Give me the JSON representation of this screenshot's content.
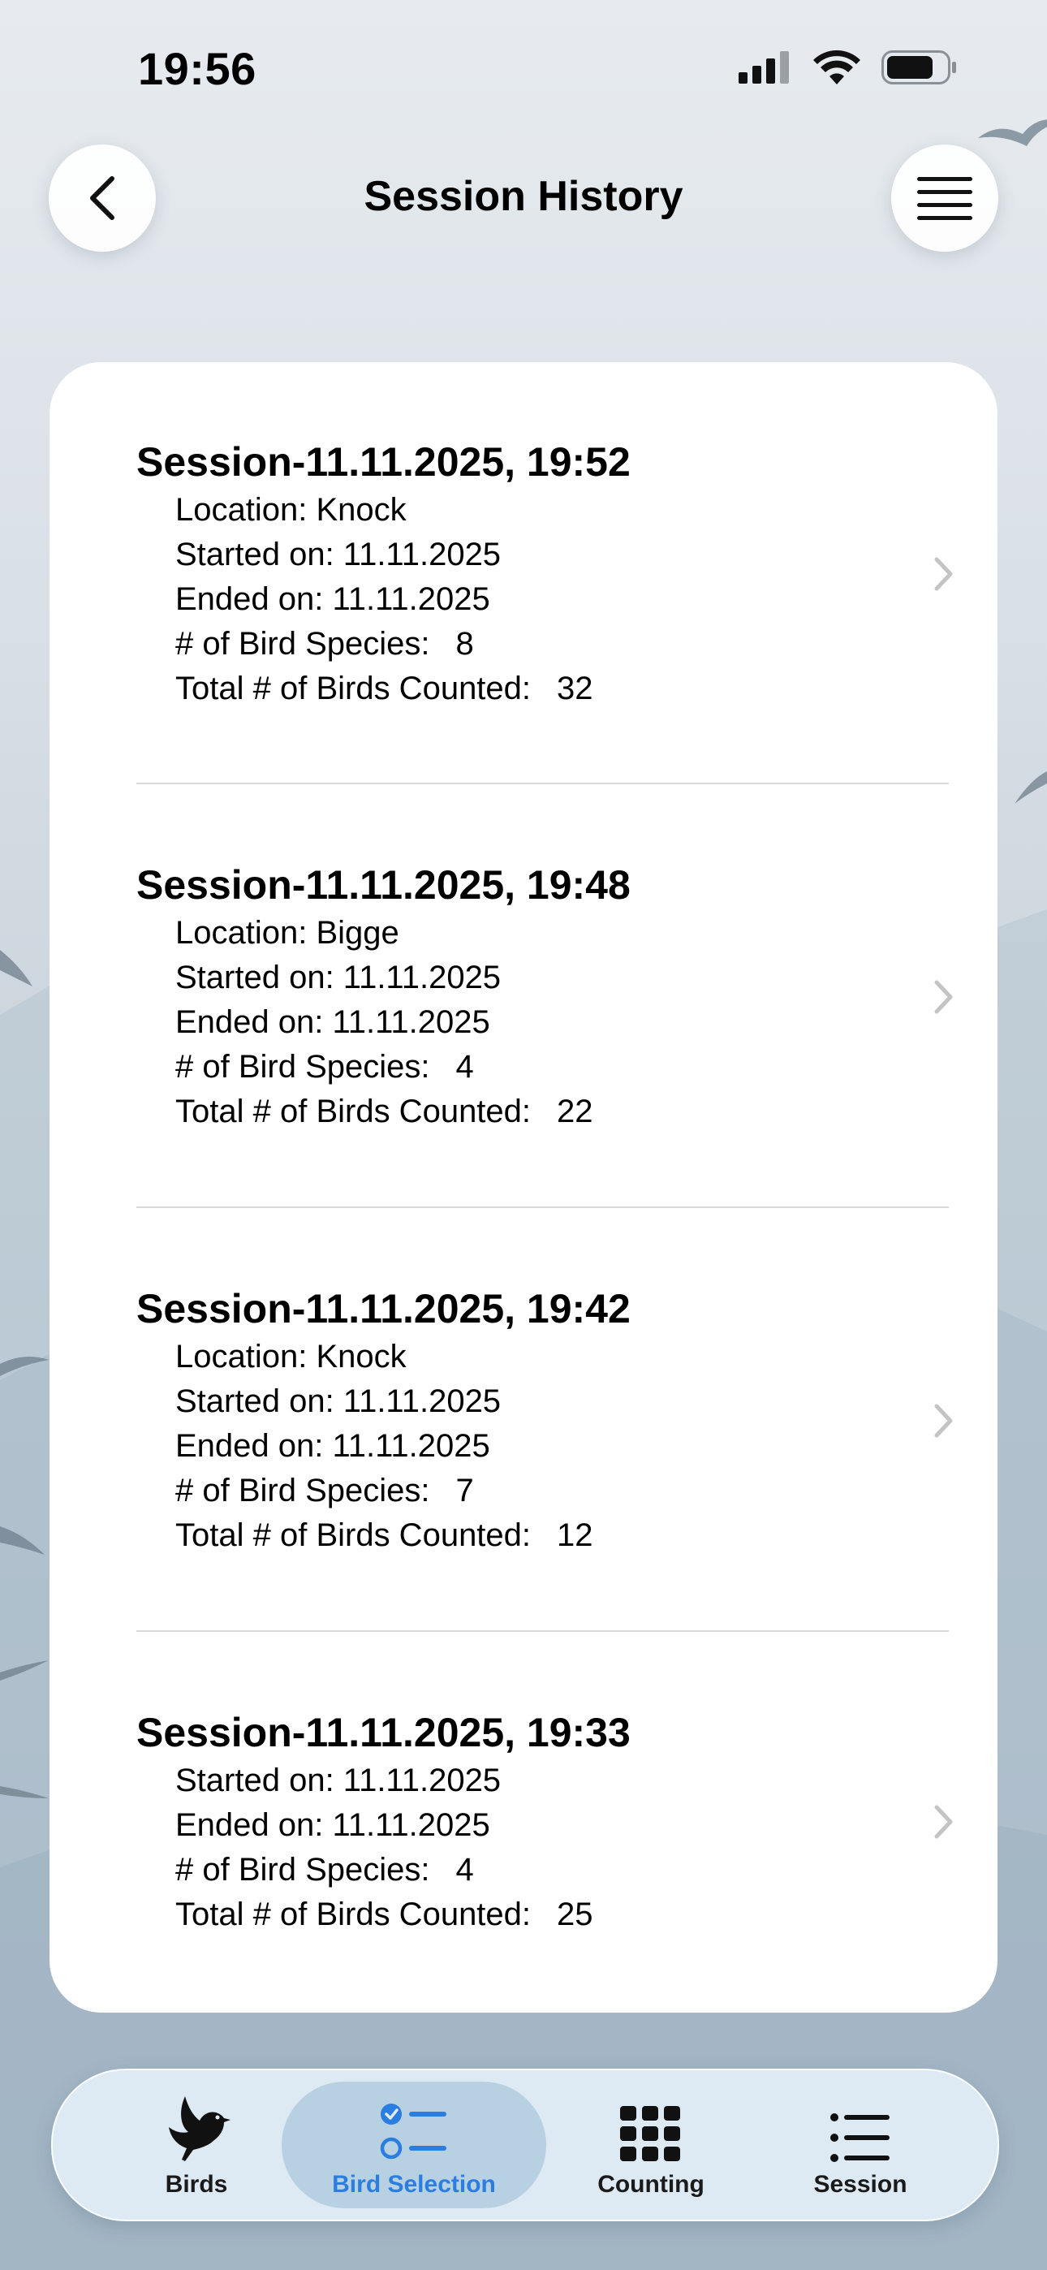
{
  "status_bar": {
    "time": "19:56"
  },
  "header": {
    "title": "Session History"
  },
  "sessions": [
    {
      "title": "Session-11.11.2025, 19:52",
      "location": "Location: Knock",
      "started": "Started on: 11.11.2025",
      "ended": "Ended on: 11.11.2025",
      "species_label": "# of Bird Species:",
      "species_value": "8",
      "total_label": "Total # of Birds Counted:",
      "total_value": "32"
    },
    {
      "title": "Session-11.11.2025, 19:48",
      "location": "Location: Bigge",
      "started": "Started on: 11.11.2025",
      "ended": "Ended on: 11.11.2025",
      "species_label": "# of Bird Species:",
      "species_value": "4",
      "total_label": "Total # of Birds Counted:",
      "total_value": "22"
    },
    {
      "title": "Session-11.11.2025, 19:42",
      "location": "Location: Knock",
      "started": "Started on: 11.11.2025",
      "ended": "Ended on: 11.11.2025",
      "species_label": "# of Bird Species:",
      "species_value": "7",
      "total_label": "Total # of Birds Counted:",
      "total_value": "12"
    },
    {
      "title": "Session-11.11.2025, 19:33",
      "started": "Started on: 11.11.2025",
      "ended": "Ended on: 11.11.2025",
      "species_label": "# of Bird Species:",
      "species_value": "4",
      "total_label": "Total # of Birds Counted:",
      "total_value": "25"
    }
  ],
  "tab_bar": {
    "tabs": [
      {
        "label": "Birds",
        "icon": "bird-icon",
        "active": false
      },
      {
        "label": "Bird Selection",
        "icon": "checklist-icon",
        "active": true
      },
      {
        "label": "Counting",
        "icon": "grid-icon",
        "active": false
      },
      {
        "label": "Session",
        "icon": "list-icon",
        "active": false
      }
    ],
    "accent_color": "#2b7de0"
  }
}
